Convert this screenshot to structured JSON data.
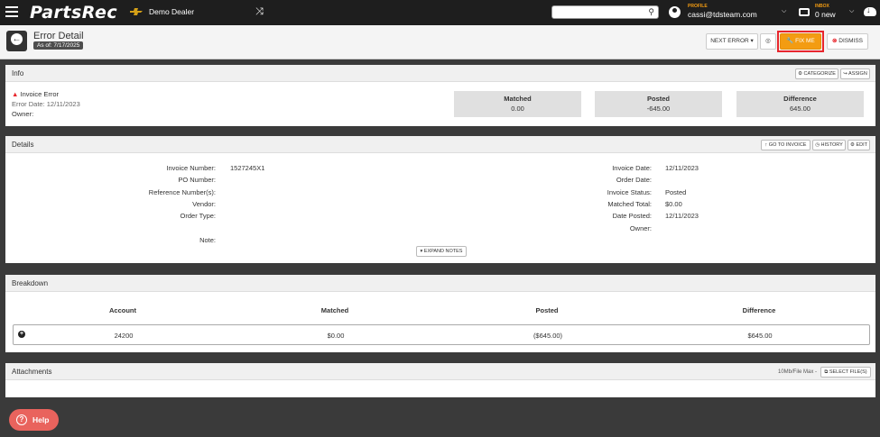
{
  "topbar": {
    "logo": "PartsRec",
    "dealer": "Demo Dealer",
    "profile_label": "PROFILE",
    "profile_email": "cassi@tdsteam.com",
    "inbox_label": "INBOX",
    "inbox_count": "0 new"
  },
  "header": {
    "title": "Error Detail",
    "as_of": "As of: 7/17/2025",
    "next_error": "NEXT ERROR ▾",
    "fix_me": "🔧 FIX ME",
    "dismiss": "DISMISS"
  },
  "info": {
    "title": "Info",
    "categorize": "⚙ CATEGORIZE",
    "assign": "↪ ASSIGN",
    "error_type": "Invoice Error",
    "error_date": "Error Date: 12/11/2023",
    "owner": "Owner:",
    "stats": [
      {
        "label": "Matched",
        "value": "0.00"
      },
      {
        "label": "Posted",
        "value": "-645.00"
      },
      {
        "label": "Difference",
        "value": "645.00"
      }
    ]
  },
  "details": {
    "title": "Details",
    "go_to_invoice": "↑ GO TO INVOICE",
    "history": "◷ HISTORY",
    "edit": "⚙ EDIT",
    "left_labels": [
      "Invoice Number:",
      "PO Number:",
      "Reference Number(s):",
      "Vendor:",
      "Order Type:"
    ],
    "left_values": [
      "1527245X1",
      "",
      "",
      "",
      ""
    ],
    "right_labels": [
      "Invoice Date:",
      "Order Date:",
      "Invoice Status:",
      "Matched Total:",
      "Date Posted:",
      "Owner:"
    ],
    "right_values": [
      "12/11/2023",
      "",
      "Posted",
      "$0.00",
      "12/11/2023",
      ""
    ],
    "note_label": "Note:",
    "expand_notes": "▾ EXPAND NOTES"
  },
  "breakdown": {
    "title": "Breakdown",
    "columns": [
      "Account",
      "Matched",
      "Posted",
      "Difference"
    ],
    "rows": [
      [
        "24200",
        "$0.00",
        "($645.00)",
        "$645.00"
      ]
    ]
  },
  "attachments": {
    "title": "Attachments",
    "file_max": "10Mb/File Max -",
    "select_files": "⧉ SELECT FILE(S)"
  },
  "help": {
    "label": "Help"
  },
  "colors": {
    "accent": "#f39c12",
    "danger": "#e8262c",
    "help": "#e9635d",
    "topbar": "#1e1e1e"
  }
}
